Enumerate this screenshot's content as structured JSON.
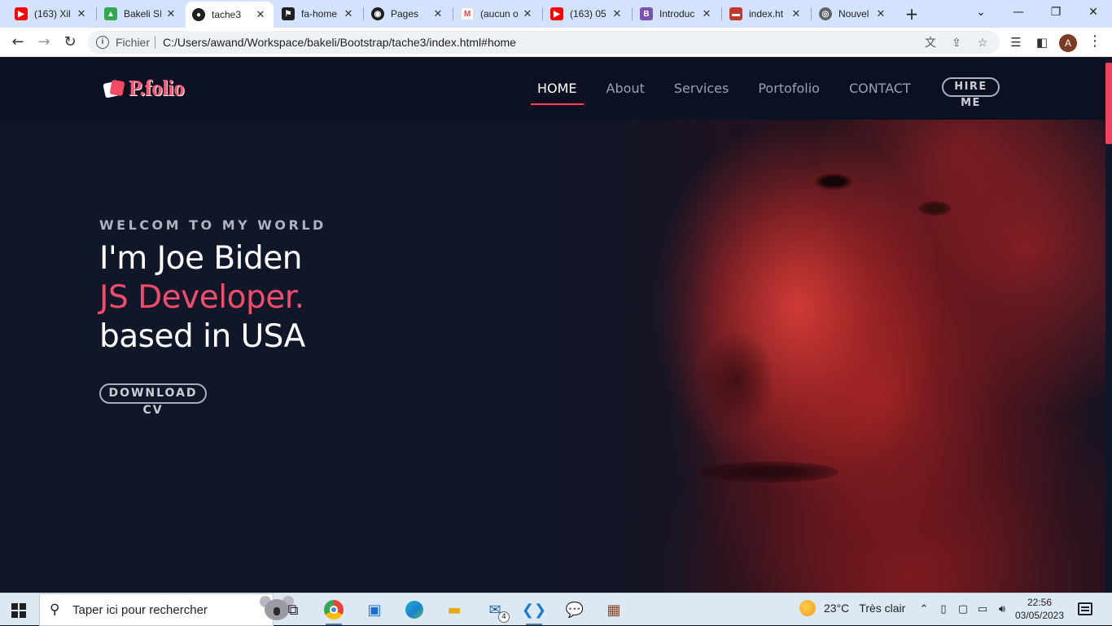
{
  "browser": {
    "tabs": [
      {
        "title": "(163) Xil",
        "icon": "youtube-icon",
        "color": "#ff0000"
      },
      {
        "title": "Bakeli SI",
        "icon": "google-drive-icon",
        "color": "#1a73e8"
      },
      {
        "title": "tache3",
        "icon": "site-favicon-icon",
        "color": "#ffffff",
        "active": true
      },
      {
        "title": "fa-home",
        "icon": "flag-favicon-icon",
        "color": "#1f1f1f"
      },
      {
        "title": "Pages",
        "icon": "github-icon",
        "color": "#1f1f1f"
      },
      {
        "title": "(aucun o",
        "icon": "gmail-icon",
        "color": "#ea4335"
      },
      {
        "title": "(163) 05",
        "icon": "youtube-icon",
        "color": "#ff0000"
      },
      {
        "title": "Introduc",
        "icon": "bootstrap-icon",
        "color": "#7952b3"
      },
      {
        "title": "index.ht",
        "icon": "file-favicon-icon",
        "color": "#c0392b"
      },
      {
        "title": "Nouvel o",
        "icon": "chrome-icon",
        "color": "#5f6368"
      }
    ],
    "scheme_label": "Fichier",
    "url": "C:/Users/awand/Workspace/bakeli/Bootstrap/tache3/index.html#home",
    "profile_initial": "A"
  },
  "site": {
    "brand": "P.folio",
    "nav": {
      "home": "HOME",
      "about": "About",
      "services": "Services",
      "portfolio": "Portofolio",
      "contact": "CONTACT",
      "hire": "HIRE ME"
    },
    "hero": {
      "eyebrow": "WELCOM TO MY WORLD",
      "line1": "I'm Joe Biden",
      "line2": "JS Developer.",
      "line3": "based in USA",
      "cta": "DOWNLOAD CV"
    },
    "colors": {
      "accent": "#f34b6b",
      "background": "#101729",
      "nav_background": "#0b1120"
    }
  },
  "taskbar": {
    "search_placeholder": "Taper ici pour rechercher",
    "weather_temp": "23°C",
    "weather_desc": "Très clair",
    "time": "22:56",
    "date": "03/05/2023",
    "mail_badge": "4"
  }
}
